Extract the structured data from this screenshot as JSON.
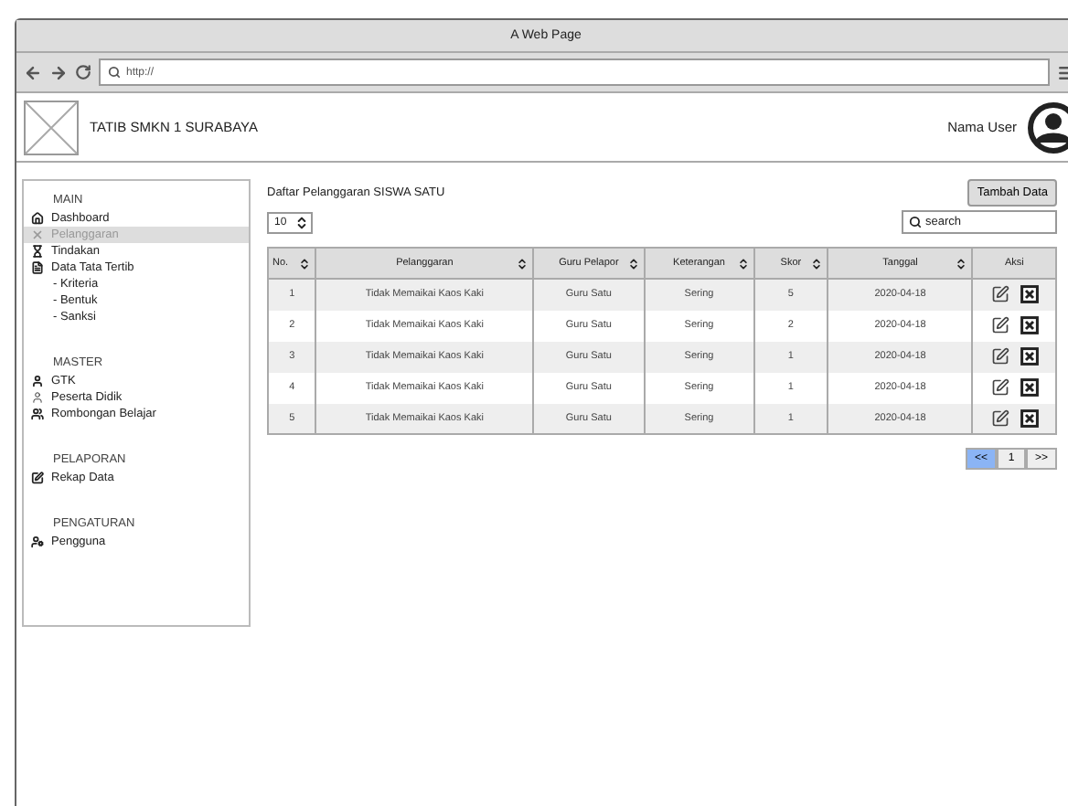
{
  "window": {
    "title": "A Web Page"
  },
  "browser": {
    "url": "http://"
  },
  "header": {
    "app_name": "TATIB SMKN 1 SURABAYA",
    "user_name": "Nama User"
  },
  "sidebar": {
    "sections": [
      {
        "title": "MAIN",
        "items": [
          {
            "label": "Dashboard",
            "kind": "item",
            "selected": false
          },
          {
            "label": "Pelanggaran",
            "kind": "item",
            "selected": true
          },
          {
            "label": "Tindakan",
            "kind": "item",
            "selected": false
          },
          {
            "label": "Data Tata Tertib",
            "kind": "item",
            "selected": false
          },
          {
            "label": "- Kriteria",
            "kind": "subitem",
            "selected": false
          },
          {
            "label": "- Bentuk",
            "kind": "subitem",
            "selected": false
          },
          {
            "label": "- Sanksi",
            "kind": "subitem",
            "selected": false
          }
        ]
      },
      {
        "title": "MASTER",
        "items": [
          {
            "label": "GTK",
            "kind": "item",
            "selected": false
          },
          {
            "label": "Peserta Didik",
            "kind": "item",
            "selected": false
          },
          {
            "label": "Rombongan Belajar",
            "kind": "item",
            "selected": false
          }
        ]
      },
      {
        "title": "PELAPORAN",
        "items": [
          {
            "label": "Rekap Data",
            "kind": "item",
            "selected": false
          }
        ]
      },
      {
        "title": "PENGATURAN",
        "items": [
          {
            "label": "Pengguna",
            "kind": "item",
            "selected": false
          }
        ]
      }
    ]
  },
  "main": {
    "title": "Daftar Pelanggaran SISWA SATU",
    "add_button": "Tambah Data",
    "page_size": "10",
    "search": {
      "placeholder": "search"
    },
    "table": {
      "columns": [
        {
          "label": "No.",
          "sortable": true
        },
        {
          "label": "Pelanggaran",
          "sortable": true
        },
        {
          "label": "Guru Pelapor",
          "sortable": true
        },
        {
          "label": "Keterangan",
          "sortable": true
        },
        {
          "label": "Skor",
          "sortable": true
        },
        {
          "label": "Tanggal",
          "sortable": true
        },
        {
          "label": "Aksi",
          "sortable": false
        }
      ],
      "rows": [
        [
          "1",
          "Tidak Memaikai Kaos Kaki",
          "Guru Satu",
          "Sering",
          "5",
          "2020-04-18"
        ],
        [
          "2",
          "Tidak Memaikai Kaos Kaki",
          "Guru Satu",
          "Sering",
          "2",
          "2020-04-18"
        ],
        [
          "3",
          "Tidak Memaikai Kaos Kaki",
          "Guru Satu",
          "Sering",
          "1",
          "2020-04-18"
        ],
        [
          "4",
          "Tidak Memaikai Kaos Kaki",
          "Guru Satu",
          "Sering",
          "1",
          "2020-04-18"
        ],
        [
          "5",
          "Tidak Memaikai Kaos Kaki",
          "Guru Satu",
          "Sering",
          "1",
          "2020-04-18"
        ]
      ]
    },
    "pagination": [
      {
        "label": "<<",
        "selected": true
      },
      {
        "label": "1",
        "selected": false
      },
      {
        "label": ">>",
        "selected": false
      }
    ]
  }
}
